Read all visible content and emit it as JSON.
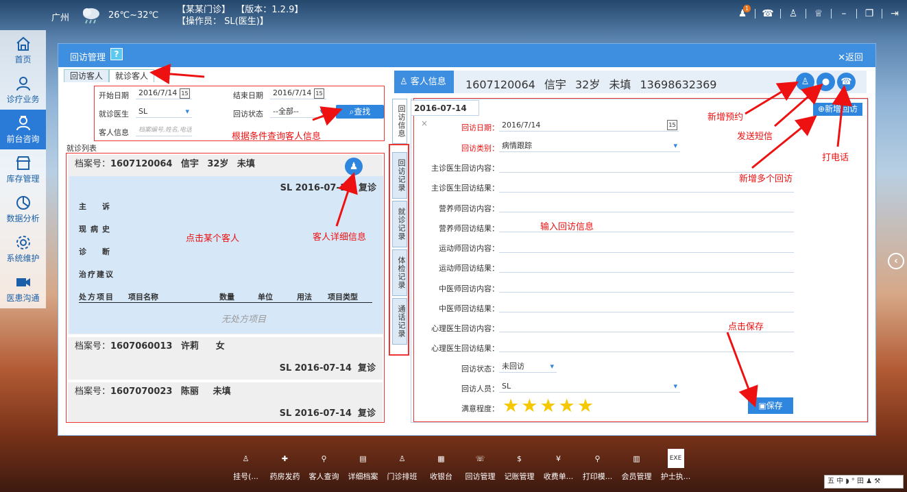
{
  "top": {
    "city": "广州",
    "temp": "26℃~32℃",
    "clinic": "【某某门诊】",
    "version": "【版本：1.2.9】",
    "operator": "【操作员： SL(医生)】",
    "badge": "1"
  },
  "sidebar": [
    {
      "label": "首页",
      "active": false
    },
    {
      "label": "诊疗业务",
      "active": false
    },
    {
      "label": "前台咨询",
      "active": true
    },
    {
      "label": "库存管理",
      "active": false
    },
    {
      "label": "数据分析",
      "active": false
    },
    {
      "label": "系统维护",
      "active": false
    },
    {
      "label": "医患沟通",
      "active": false
    }
  ],
  "window": {
    "title": "回访管理",
    "help": "?",
    "back": "返回"
  },
  "tabs": [
    "回访客人",
    "就诊客人"
  ],
  "filter": {
    "start_label": "开始日期",
    "start": "2016/7/14",
    "end_label": "结束日期",
    "end": "2016/7/14",
    "doctor_label": "就诊医生",
    "doctor": "SL",
    "status_label": "回访状态",
    "status": "--全部--",
    "info_label": "客人信息",
    "info_placeholder": "档案编号,姓名,电话",
    "search": "查找"
  },
  "list_label": "就诊列表",
  "patients": [
    {
      "id_label": "档案号：",
      "id": "1607120064",
      "name": "信宇",
      "age": "32岁",
      "gender": "未填",
      "doctor_date": "SL  2016-07-14",
      "type": "复诊"
    },
    {
      "id_label": "档案号：",
      "id": "1607060013",
      "name": "许莉",
      "age": "",
      "gender": "女",
      "doctor_date": "SL  2016-07-14",
      "type": "复诊"
    },
    {
      "id_label": "档案号：",
      "id": "1607070023",
      "name": "陈丽",
      "age": "",
      "gender": "未填",
      "doctor_date": "SL  2016-07-14",
      "type": "复诊"
    }
  ],
  "detail": {
    "complaint": "主　诉",
    "history": "现病史",
    "diagnosis": "诊　断",
    "advice": "治疗建议",
    "rx": "处方项目",
    "cols": [
      "项目名称",
      "数量",
      "单位",
      "用法",
      "项目类型"
    ],
    "empty": "无处方项目"
  },
  "vtabs": [
    "回访信息",
    "回访记录",
    "就诊记录",
    "体检记录",
    "通话记录"
  ],
  "customer": {
    "label": "客人信息",
    "text": "1607120064  信宇  32岁  未填  13698632369"
  },
  "form": {
    "tab": "2016-07-14",
    "close": "×",
    "add": "新增回访",
    "date_label": "回访日期：",
    "date": "2016/7/14",
    "cat_label": "回访类别：",
    "cat": "病情跟踪",
    "fields": [
      "主诊医生回访内容：",
      "主诊医生回访结果：",
      "营养师回访内容：",
      "营养师回访结果：",
      "运动师回访内容：",
      "运动师回访结果：",
      "中医师回访内容：",
      "中医师回访结果：",
      "心理医生回访内容：",
      "心理医生回访结果："
    ],
    "status_label": "回访状态：",
    "status": "未回访",
    "person_label": "回访人员：",
    "person": "SL",
    "sat_label": "满意程度：",
    "rating": 5,
    "save": "保存"
  },
  "annotations": {
    "a1": "根据条件查询客人信息",
    "a2": "点击某个客人",
    "a3": "客人详细信息",
    "a4": "新增预约",
    "a5": "发送短信",
    "a6": "打电话",
    "a7": "新增多个回访",
    "a8": "输入回访信息",
    "a9": "点击保存"
  },
  "taskbar": [
    "挂号(...",
    "药房发药",
    "客人查询",
    "详细档案",
    "门诊排班",
    "收银台",
    "回访管理",
    "记账管理",
    "收费单...",
    "打印模...",
    "会员管理",
    "护士执..."
  ],
  "sysbar": "五 中 ◗ ° 田 ♟ ⚒"
}
